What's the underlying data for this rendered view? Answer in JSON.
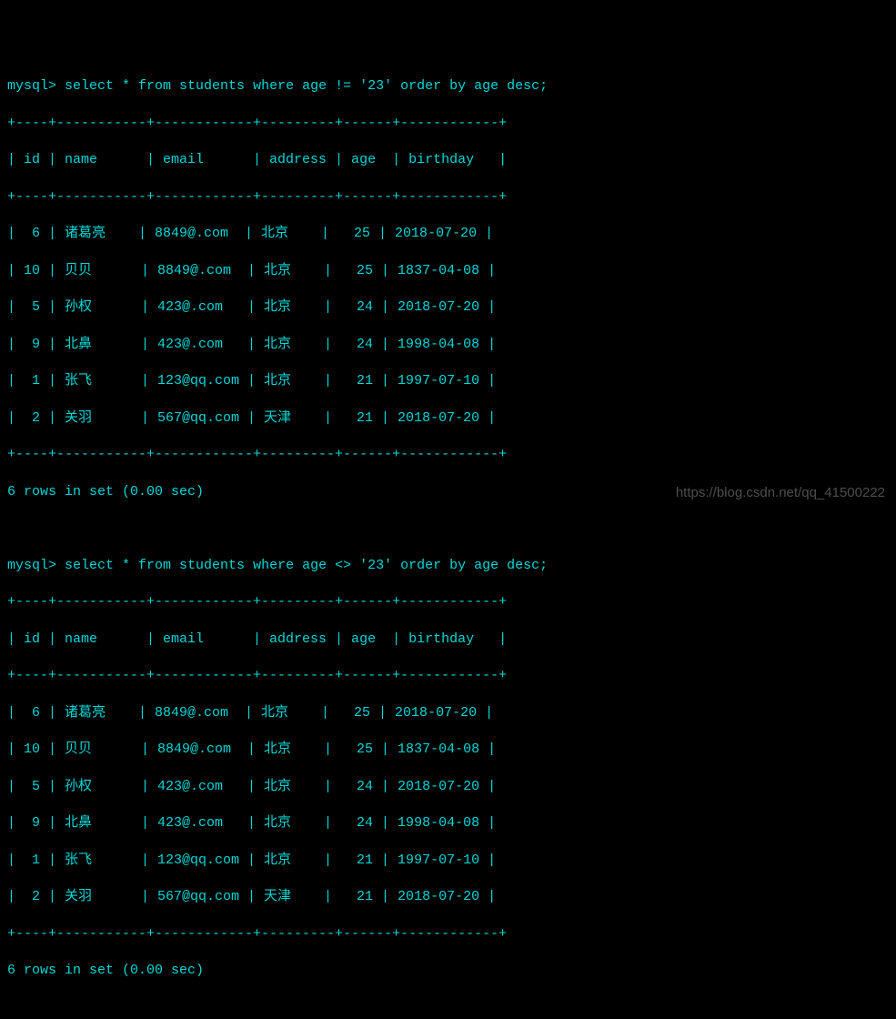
{
  "prompt": "mysql>",
  "queries": [
    {
      "sql": "select * from students where age != '23' order by age desc;",
      "border_top": "+----+-----------+------------+---------+------+------------+",
      "header_line": "| id | name      | email      | address | age  | birthday   |",
      "border_mid": "+----+-----------+------------+---------+------+------------+",
      "rows": [
        "|  6 | 诸葛亮    | 8849@.com  | 北京    |   25 | 2018-07-20 |",
        "| 10 | 贝贝      | 8849@.com  | 北京    |   25 | 1837-04-08 |",
        "|  5 | 孙权      | 423@.com   | 北京    |   24 | 2018-07-20 |",
        "|  9 | 北鼻      | 423@.com   | 北京    |   24 | 1998-04-08 |",
        "|  1 | 张飞      | 123@qq.com | 北京    |   21 | 1997-07-10 |",
        "|  2 | 关羽      | 567@qq.com | 天津    |   21 | 2018-07-20 |"
      ],
      "border_bot": "+----+-----------+------------+---------+------+------------+",
      "status": "6 rows in set (0.00 sec)"
    },
    {
      "sql": "select * from students where age <> '23' order by age desc;",
      "border_top": "+----+-----------+------------+---------+------+------------+",
      "header_line": "| id | name      | email      | address | age  | birthday   |",
      "border_mid": "+----+-----------+------------+---------+------+------------+",
      "rows": [
        "|  6 | 诸葛亮    | 8849@.com  | 北京    |   25 | 2018-07-20 |",
        "| 10 | 贝贝      | 8849@.com  | 北京    |   25 | 1837-04-08 |",
        "|  5 | 孙权      | 423@.com   | 北京    |   24 | 2018-07-20 |",
        "|  9 | 北鼻      | 423@.com   | 北京    |   24 | 1998-04-08 |",
        "|  1 | 张飞      | 123@qq.com | 北京    |   21 | 1997-07-10 |",
        "|  2 | 关羽      | 567@qq.com | 天津    |   21 | 2018-07-20 |"
      ],
      "border_bot": "+----+-----------+------------+---------+------+------------+",
      "status": "6 rows in set (0.00 sec)"
    }
  ],
  "chart_data": {
    "type": "table",
    "columns": [
      "id",
      "name",
      "email",
      "address",
      "age",
      "birthday"
    ],
    "rows": [
      {
        "id": 6,
        "name": "诸葛亮",
        "email": "8849@.com",
        "address": "北京",
        "age": 25,
        "birthday": "2018-07-20"
      },
      {
        "id": 10,
        "name": "贝贝",
        "email": "8849@.com",
        "address": "北京",
        "age": 25,
        "birthday": "1837-04-08"
      },
      {
        "id": 5,
        "name": "孙权",
        "email": "423@.com",
        "address": "北京",
        "age": 24,
        "birthday": "2018-07-20"
      },
      {
        "id": 9,
        "name": "北鼻",
        "email": "423@.com",
        "address": "北京",
        "age": 24,
        "birthday": "1998-04-08"
      },
      {
        "id": 1,
        "name": "张飞",
        "email": "123@qq.com",
        "address": "北京",
        "age": 21,
        "birthday": "1997-07-10"
      },
      {
        "id": 2,
        "name": "关羽",
        "email": "567@qq.com",
        "address": "天津",
        "age": 21,
        "birthday": "2018-07-20"
      }
    ]
  },
  "watermark": "https://blog.csdn.net/qq_41500222"
}
